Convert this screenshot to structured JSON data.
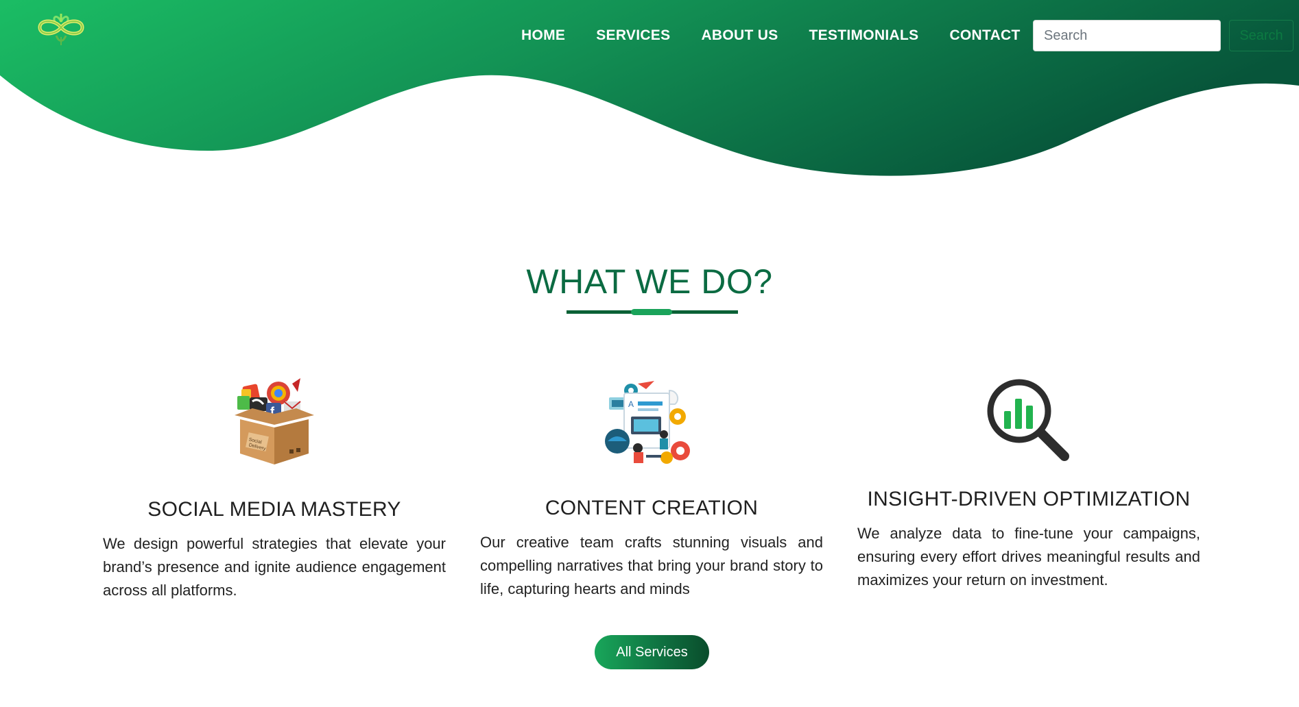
{
  "brand": {
    "logo_icon": "infinity-leaf-logo",
    "colors": {
      "primary_light": "#1db862",
      "primary_dark": "#0a5c3a",
      "heading_green": "#0b6b42"
    }
  },
  "nav": {
    "items": [
      {
        "label": "HOME"
      },
      {
        "label": "SERVICES"
      },
      {
        "label": "ABOUT US"
      },
      {
        "label": "TESTIMONIALS"
      },
      {
        "label": "CONTACT"
      }
    ],
    "search": {
      "placeholder": "Search",
      "button_label": "Search"
    }
  },
  "section": {
    "title": "WHAT WE DO?",
    "cards": [
      {
        "icon": "social-box-icon",
        "title": "SOCIAL MEDIA MASTERY",
        "text": "We design powerful strategies that elevate your brand’s presence and ignite audience engagement across all platforms."
      },
      {
        "icon": "content-creation-icon",
        "title": "CONTENT CREATION",
        "text": "Our creative team crafts stunning visuals and compelling narratives that bring your brand story to life, capturing hearts and minds"
      },
      {
        "icon": "magnifier-chart-icon",
        "title": "INSIGHT-DRIVEN OPTIMIZATION",
        "text": "We analyze data to fine-tune your campaigns, ensuring every effort drives meaningful results and maximizes your return on investment."
      }
    ],
    "cta_label": "All Services"
  }
}
